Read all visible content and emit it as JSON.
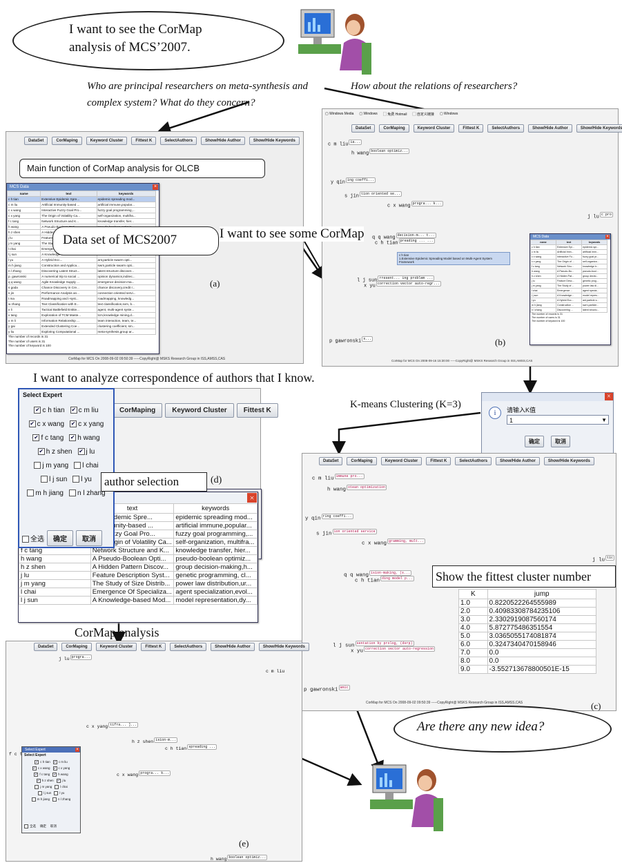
{
  "captions": {
    "cloud_top": "I want to see the CorMap analysis of MCS’2007.",
    "question_researchers": "Who are principal researchers on meta-synthesis and complex system? What do they concern?",
    "question_relations": "How about the relations of researchers?",
    "main_function": "Main function of CorMap analysis for OLCB",
    "dataset_label": "Data set of MCS2007",
    "see_cormap": "I want to see some CorMap",
    "analyze_correspondence": "I want to analyze correspondence of authors that I know.",
    "kmeans": "K-means Clustering (K=3)",
    "author_selection": "author selection",
    "show_fittest": "Show the fittest cluster number",
    "cormap_analysis": "CorMap analysis",
    "new_idea": "Are there any new idea?"
  },
  "panel_labels": {
    "a": "(a)",
    "b": "(b)",
    "c": "(c)",
    "d": "(d)",
    "e": "(e)"
  },
  "toolbar": {
    "dataset": "DataSet",
    "cormaping": "CorMaping",
    "keyword_cluster": "Keyword Cluster",
    "fittest_k": "Fittest K",
    "select_authors": "SelectAuthors",
    "show_hide_author": "Show/Hide Author",
    "show_hide_keywords": "Show/Hide Keywords"
  },
  "footer_a": "CorMap for MCS On 2008-09-02 09:50:39 -----CopyRight@ MSKS Research Group in ISS,AMSS,CAS",
  "footer_b": "CorMap for MCS On 2008-09-16 15:30:00 -----CopyRight@ MSKS Research Group in ISS,AMSS,CAS",
  "footer_c": "CorMap for MCS On 2008-09-02 09:50:39 -----CopyRight@ MSKS Research Group in ISS,AMSS,CAS",
  "data_window": {
    "title": "MCS Data",
    "headers": [
      "name",
      "text",
      "keywords"
    ],
    "rows": [
      [
        "c h tian",
        "Extensive Epidemic Spre...",
        "epidemic spreading mod..."
      ],
      [
        "c m liu",
        "Artificial Immunity-based ...",
        "artificial immune,popular..."
      ],
      [
        "c x wang",
        "Interactive Fuzzy Goal Pro...",
        "fuzzy goal programming,..."
      ],
      [
        "c x yang",
        "The Origin of Volatility Ca...",
        "self-organization, multifra..."
      ],
      [
        "f c tang",
        "Network Structure and K...",
        "knowledge transfer, hier..."
      ],
      [
        "h wang",
        "A Pseudo-Boolean Opti...",
        "pseudo-boolean optimiz..."
      ],
      [
        "h z shen",
        "A Hidden Pattern Discov...",
        "group decision-making,h..."
      ],
      [
        "j lu",
        "Feature Description Syst...",
        "genetic programming, cl..."
      ],
      [
        "j m yang",
        "The Study of Size Distrib...",
        "power law distribution,ur..."
      ],
      [
        "l chai",
        "Emergence Of Specializa...",
        "agent specialization,evol..."
      ],
      [
        "l j sun",
        "A Knowledge-based Mod...",
        "model representation,dy..."
      ],
      [
        "l yu",
        "A Hybrid Ecc...",
        "ant,particle swarm opti..."
      ],
      [
        "m h jiang",
        "Construction and Applica...",
        "swrn,particle swarm opti..."
      ],
      [
        "n l zhang",
        "Discovering Latent Struct...",
        "latent structure discover..."
      ],
      [
        "p. gawronski",
        "A numerical trip to social ...",
        "opinion dynamics,indirec..."
      ],
      [
        "q q wang",
        "Agile Knowledge Supply ...",
        "emergence decision-ma..."
      ],
      [
        "s goda",
        "Chance Discovery in Cre...",
        "chance discovery,credit r..."
      ],
      [
        "s jin",
        "Performance Analysis an...",
        "connection oriented servi..."
      ],
      [
        "t ma",
        "Roadmapping and i-syst...",
        "roadmapping, knowledg..."
      ],
      [
        "w zhang",
        "Text Classification with E...",
        "text classification,svm, b..."
      ],
      [
        "x li",
        "Tactical Battlefield Entitie...",
        "agent, multi-agent syste..."
      ],
      [
        "x tang",
        "Exploration of TCM Maste...",
        "tcm,knowledge mining,d..."
      ],
      [
        "x m li",
        "Information Relationship ...",
        "team interaction, team, te..."
      ],
      [
        "y gai",
        "Extended Clustering Coe...",
        "clustering coefficient, sm..."
      ],
      [
        "y liu",
        "Exploring Computational ...",
        "meta-synthesis,group ar..."
      ]
    ],
    "status": [
      "The number of records is 31",
      "The number of users is 31",
      "The number of keyword is 100"
    ]
  },
  "cormap_b": {
    "nodes": [
      {
        "name": "c m  liu",
        "tag": "ia..."
      },
      {
        "name": "h wang",
        "tag": "boolean optimiz..."
      },
      {
        "name": "y qin",
        "tag": "ing coeffi..."
      },
      {
        "name": "s jin",
        "tag": "tion oriented se..."
      },
      {
        "name": "c x wang",
        "tag": "progra... k..."
      },
      {
        "name": "j lu",
        "tag": "c pro"
      },
      {
        "name": "q q wang",
        "tag": "decision-m... t..."
      },
      {
        "name": "c h tian",
        "tag": "preading ... ..."
      },
      {
        "name": "l j sun",
        "tag": "rresent... ing problem ..."
      },
      {
        "name": "x yu",
        "tag": "correction vector auto-regr..."
      },
      {
        "name": "p  gawronski",
        "tag": "s..."
      }
    ],
    "tooltip": [
      "c h tian",
      "1.Extensive Epidemic Spreading Model based on Multi-Agent System Framework"
    ],
    "mini_rows": [
      [
        "c h tian",
        "Extensive Epi...",
        "epidemic spr..."
      ],
      [
        "c m liu",
        "Artificial Imm...",
        "artificial imm..."
      ],
      [
        "c x wang",
        "Interactive Fu...",
        "fuzzy goal pr..."
      ],
      [
        "c x yang",
        "The Origin of ...",
        "self-organiza..."
      ],
      [
        "f c tang",
        "Network Stru...",
        "knowledge tr..."
      ],
      [
        "h wang",
        "A Pseudo-Bo...",
        "pseudo-bool..."
      ],
      [
        "h z shen",
        "A Hidden Pat...",
        "group decisi..."
      ],
      [
        "j lu",
        "Feature Desc...",
        "genetic prog..."
      ],
      [
        "j m yang",
        "The Study of ...",
        "power law di..."
      ],
      [
        "l chai",
        "Emergence ...",
        "agent specia..."
      ],
      [
        "l j sun",
        "A Knowledge...",
        "model repres..."
      ],
      [
        "l yu",
        "A Hybrid Ecc...",
        "ant,particle s..."
      ],
      [
        "m h jiang",
        "Construction ...",
        "swrn,particle..."
      ],
      [
        "n l zhang",
        "Discovering ...",
        "latent structu..."
      ]
    ],
    "menu": [
      "Windows Media",
      "Windows",
      "免费 Hotmail",
      "自定义链接",
      "Windows"
    ]
  },
  "dialog_k": {
    "prompt": "请输入K值",
    "value": "1",
    "ok": "确定",
    "cancel": "取消"
  },
  "cormap_c": {
    "nodes": [
      {
        "name": "c m  liu",
        "tag": "immune pro..."
      },
      {
        "name": "h wang",
        "tag": "otean optimization"
      },
      {
        "name": "y qin",
        "tag": "ring coeffi..."
      },
      {
        "name": "s jin",
        "tag": "ion oriented service"
      },
      {
        "name": "c x  wang",
        "tag": "gramming, mult..."
      },
      {
        "name": "j lu",
        "tag": "tic"
      },
      {
        "name": "q q  wang",
        "tag": "ision-making, (s..."
      },
      {
        "name": "c h tian",
        "tag": "ding model p..."
      },
      {
        "name": "l j sun",
        "tag": "sentation by prolog, (dsrp)"
      },
      {
        "name": "x yu",
        "tag": "correction vector auto-regression"
      },
      {
        "name": "p  gawronski",
        "tag": "amic"
      }
    ]
  },
  "jump_table": {
    "headers": [
      "K",
      "jump"
    ],
    "rows": [
      [
        "1.0",
        "0.8220522264555989"
      ],
      [
        "2.0",
        "0.40983308784235106"
      ],
      [
        "3.0",
        "2.3302919087560174"
      ],
      [
        "4.0",
        "5.872775486351554"
      ],
      [
        "5.0",
        "3.0365055174081874"
      ],
      [
        "6.0",
        "0.3247340470158946"
      ],
      [
        "7.0",
        "0.0"
      ],
      [
        "8.0",
        "0.0"
      ],
      [
        "9.0",
        "-3.552713678800501E-15"
      ]
    ]
  },
  "select_expert": {
    "title": "Select Expert",
    "pairs": [
      [
        {
          "label": "c h tian",
          "checked": true
        },
        {
          "label": "c m liu",
          "checked": true
        }
      ],
      [
        {
          "label": "c x wang",
          "checked": true
        },
        {
          "label": "c x yang",
          "checked": true
        }
      ],
      [
        {
          "label": "f c tang",
          "checked": true
        },
        {
          "label": "h wang",
          "checked": true
        }
      ],
      [
        {
          "label": "h z shen",
          "checked": true
        },
        {
          "label": "j lu",
          "checked": true
        }
      ],
      [
        {
          "label": "j m yang",
          "checked": false
        },
        {
          "label": "l chai",
          "checked": false
        }
      ],
      [
        {
          "label": "l j sun",
          "checked": false
        },
        {
          "label": "l yu",
          "checked": false
        }
      ],
      [
        {
          "label": "m h jiang",
          "checked": false
        },
        {
          "label": "n l zhang",
          "checked": false
        }
      ]
    ],
    "select_all": "全选",
    "ok": "确定",
    "cancel": "取消"
  },
  "d_table": {
    "headers": [
      "text",
      "keywords"
    ],
    "rows": [
      [
        "c h tian",
        "tive Epidemic Spre...",
        "epidemic spreading mod..."
      ],
      [
        "c m liu",
        "al Immunity-based ...",
        "artificial immune,popular..."
      ],
      [
        "c x wang",
        "tive Fuzzy Goal Pro...",
        "fuzzy goal programming,..."
      ],
      [
        "c x yang",
        "The Origin of Volatility Ca...",
        "self-organization, multifra..."
      ],
      [
        "f c tang",
        "Network Structure and K...",
        "knowledge transfer, hier..."
      ],
      [
        "h wang",
        "A Pseudo-Boolean Opti...",
        "pseudo-boolean optimiz..."
      ],
      [
        "h z shen",
        "A Hidden Pattern Discov...",
        "group decision-making,h..."
      ],
      [
        "j lu",
        "Feature Description Syst...",
        "genetic programming, cl..."
      ],
      [
        "j m yang",
        "The Study of Size Distrib...",
        "power law distribution,ur..."
      ],
      [
        "l chai",
        "Emergence Of Specializa...",
        "agent specialization,evol..."
      ],
      [
        "l j sun",
        "A Knowledge-based Mod...",
        "model representation,dy..."
      ]
    ]
  },
  "cormap_e": {
    "nodes": [
      {
        "name": "j lu",
        "tag": "progra..."
      },
      {
        "name": "c m  liu",
        "tag": ""
      },
      {
        "name": "c x yang",
        "tag": "tifra... ]..."
      },
      {
        "name": "h z shen",
        "tag": "ision-m..."
      },
      {
        "name": "c h tian",
        "tag": "spreading ..."
      },
      {
        "name": "f c tang",
        "tag": "tra..."
      },
      {
        "name": "c x  wang",
        "tag": "progra... k..."
      },
      {
        "name": "h wang",
        "tag": "boolean optimiz..."
      }
    ]
  }
}
